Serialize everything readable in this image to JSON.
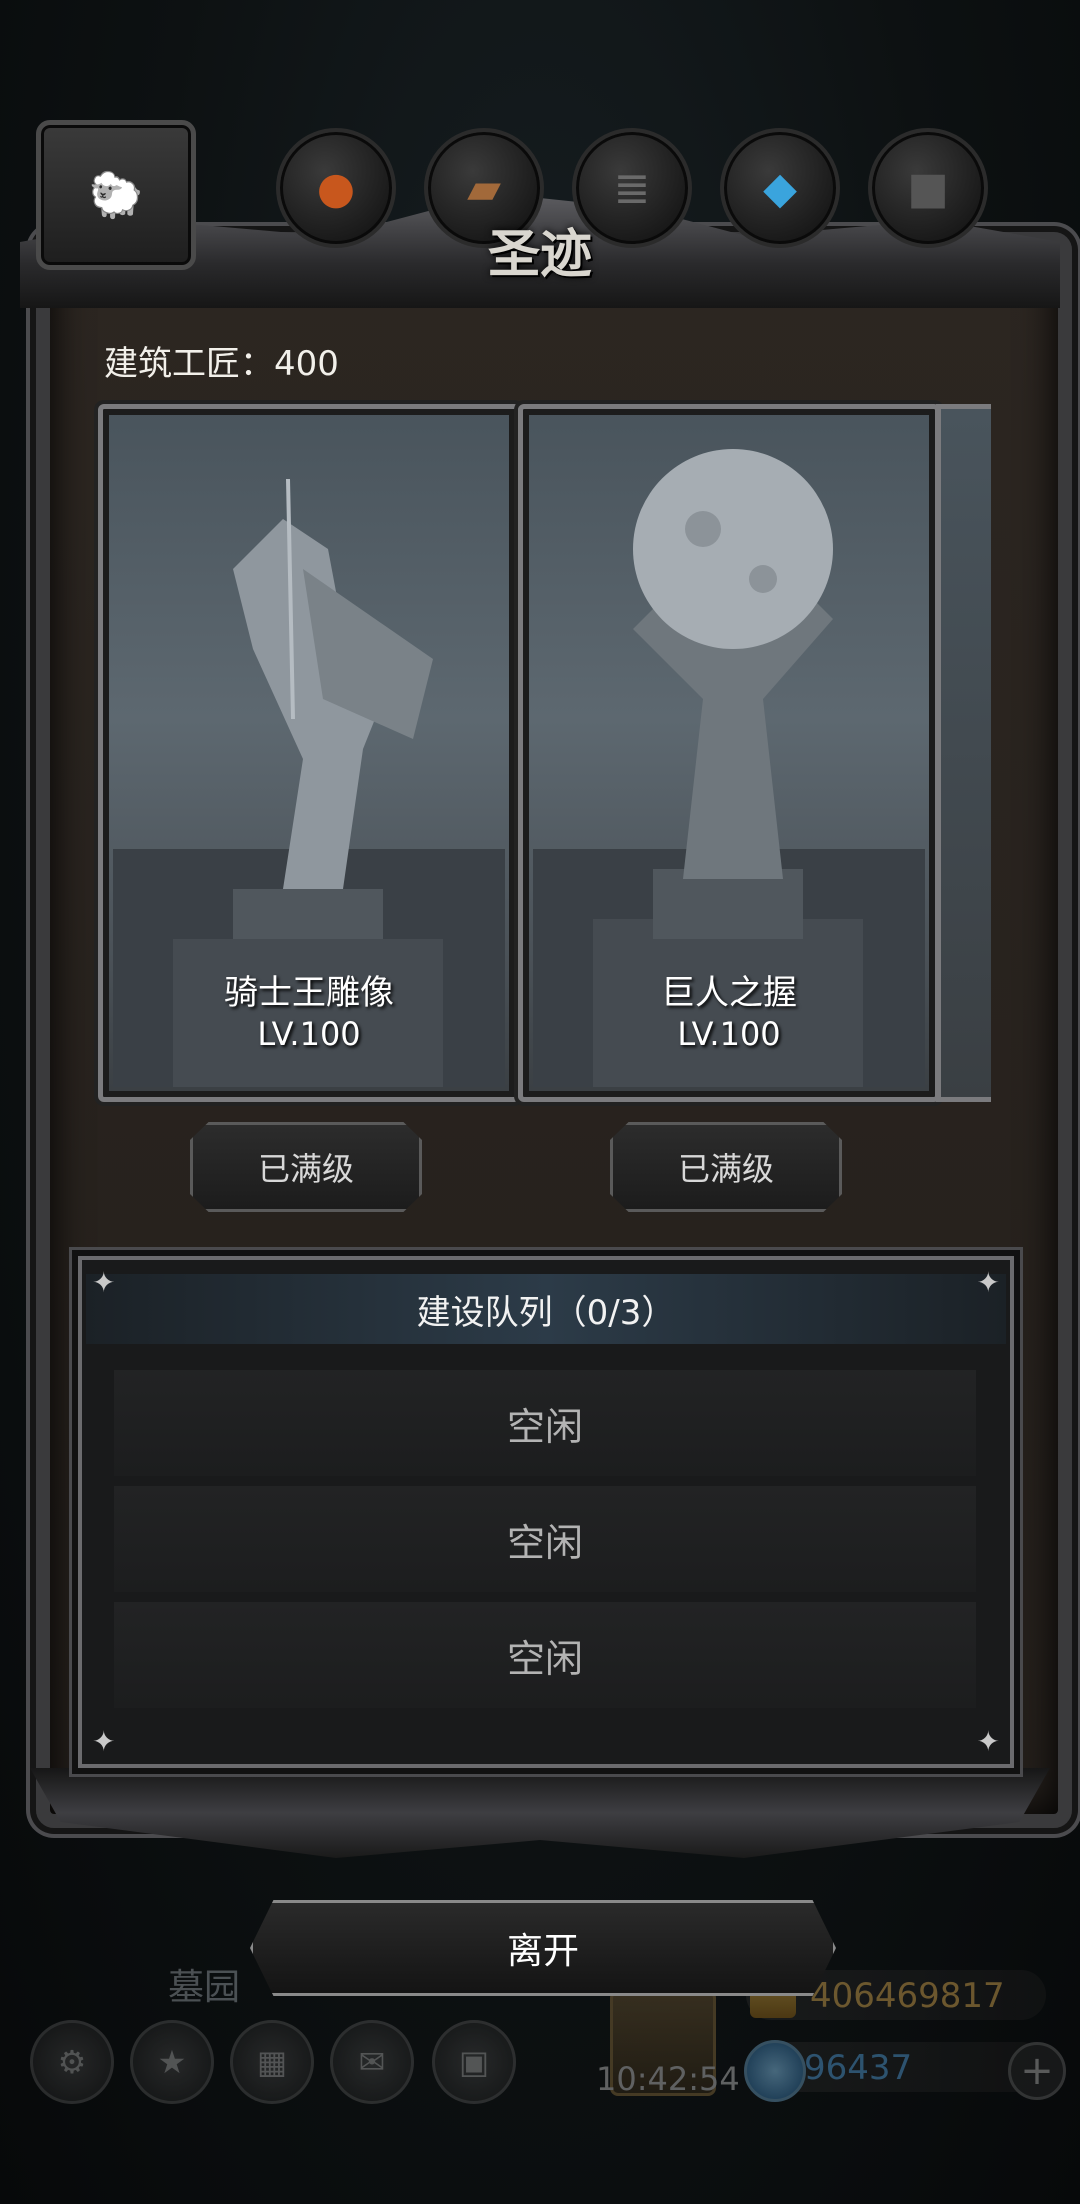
{
  "tabs": [
    {
      "name": "sheep",
      "glyph": "🐑",
      "active": true
    },
    {
      "name": "orange",
      "glyph": "●"
    },
    {
      "name": "wood",
      "glyph": "▰"
    },
    {
      "name": "stone",
      "glyph": "≣"
    },
    {
      "name": "crystal",
      "glyph": "◆"
    },
    {
      "name": "iron",
      "glyph": "■"
    }
  ],
  "panel": {
    "title": "圣迹",
    "craftsmen_label": "建筑工匠：400"
  },
  "buildings": [
    {
      "name": "骑士王雕像",
      "level": "LV.100",
      "button": "已满级"
    },
    {
      "name": "巨人之握",
      "level": "LV.100",
      "button": "已满级"
    }
  ],
  "queue": {
    "title": "建设队列（0/3）",
    "slots": [
      "空闲",
      "空闲",
      "空闲"
    ]
  },
  "leave_button": "离开",
  "hud": {
    "location_label": "墓园",
    "clock": "10:42:54",
    "gold": "406469817",
    "gems": "96437",
    "plus": "+"
  },
  "colors": {
    "panel_bg": "#2c2621",
    "gold_text": "#e3b256",
    "gem_text": "#59a8e6",
    "notification": "#c4161c"
  }
}
